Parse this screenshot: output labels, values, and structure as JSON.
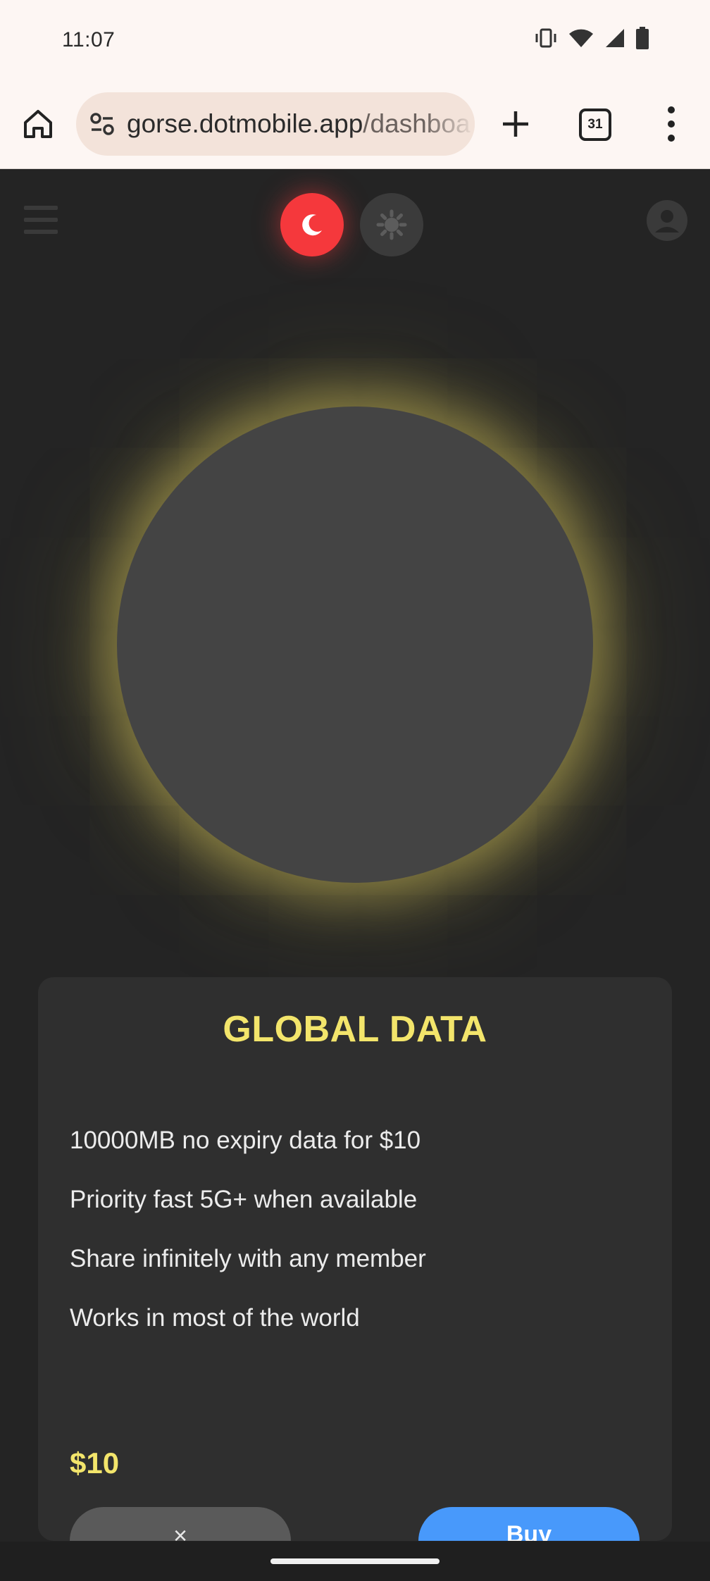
{
  "status_bar": {
    "time": "11:07",
    "icons": [
      "vibrate-icon",
      "wifi-icon",
      "signal-icon",
      "battery-icon"
    ]
  },
  "browser": {
    "url_domain": "gorse.dotmobile.app",
    "url_path": "/dashboa",
    "tab_count": "31",
    "icons": [
      "home-icon",
      "site-settings-icon",
      "plus-icon",
      "tab-switcher-icon",
      "more-vert-icon"
    ]
  },
  "app_header": {
    "icons": [
      "hamburger-menu-icon",
      "moon-icon",
      "sun-icon",
      "account-icon"
    ],
    "active_theme": "dark"
  },
  "plan_card": {
    "title": "GLOBAL DATA",
    "features": [
      "10000MB no expiry data for $10",
      "Priority fast 5G+ when available",
      "Share infinitely with any member",
      "Works in most of the world"
    ],
    "price": "$10",
    "close_label": "×",
    "buy_label": "Buy"
  },
  "colors": {
    "accent_yellow": "#f3e56b",
    "dark_mode_red": "#f5383c",
    "buy_blue": "#4899fb",
    "background": "#242424",
    "card": "#2f2f2f"
  }
}
